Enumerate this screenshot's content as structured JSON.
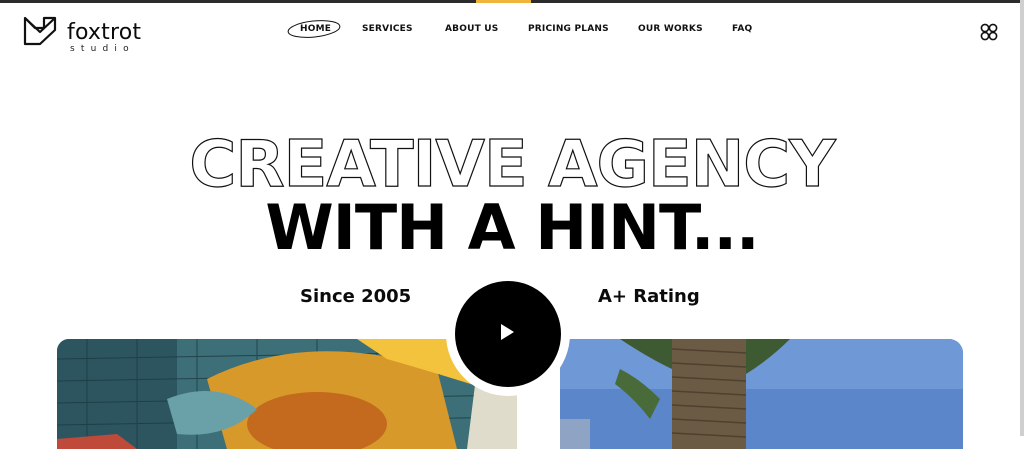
{
  "brand": {
    "name": "foxtrot",
    "sub": "studio"
  },
  "nav": [
    "HOME",
    "SERVICES",
    "ABOUT US",
    "PRICING PLANS",
    "OUR WORKS",
    "FAQ"
  ],
  "hero": {
    "line1": "CREATIVE AGENCY",
    "line2": "WITH A HINT..."
  },
  "stats": {
    "left": "Since 2005",
    "right": "A+ Rating"
  },
  "colors": {
    "accent": "#f0b43a",
    "text": "#0b0b0b",
    "background": "#ffffff"
  },
  "icons": {
    "menu": "four-dots-menu-icon",
    "play": "play-icon",
    "logo": "fox-logo-icon"
  }
}
